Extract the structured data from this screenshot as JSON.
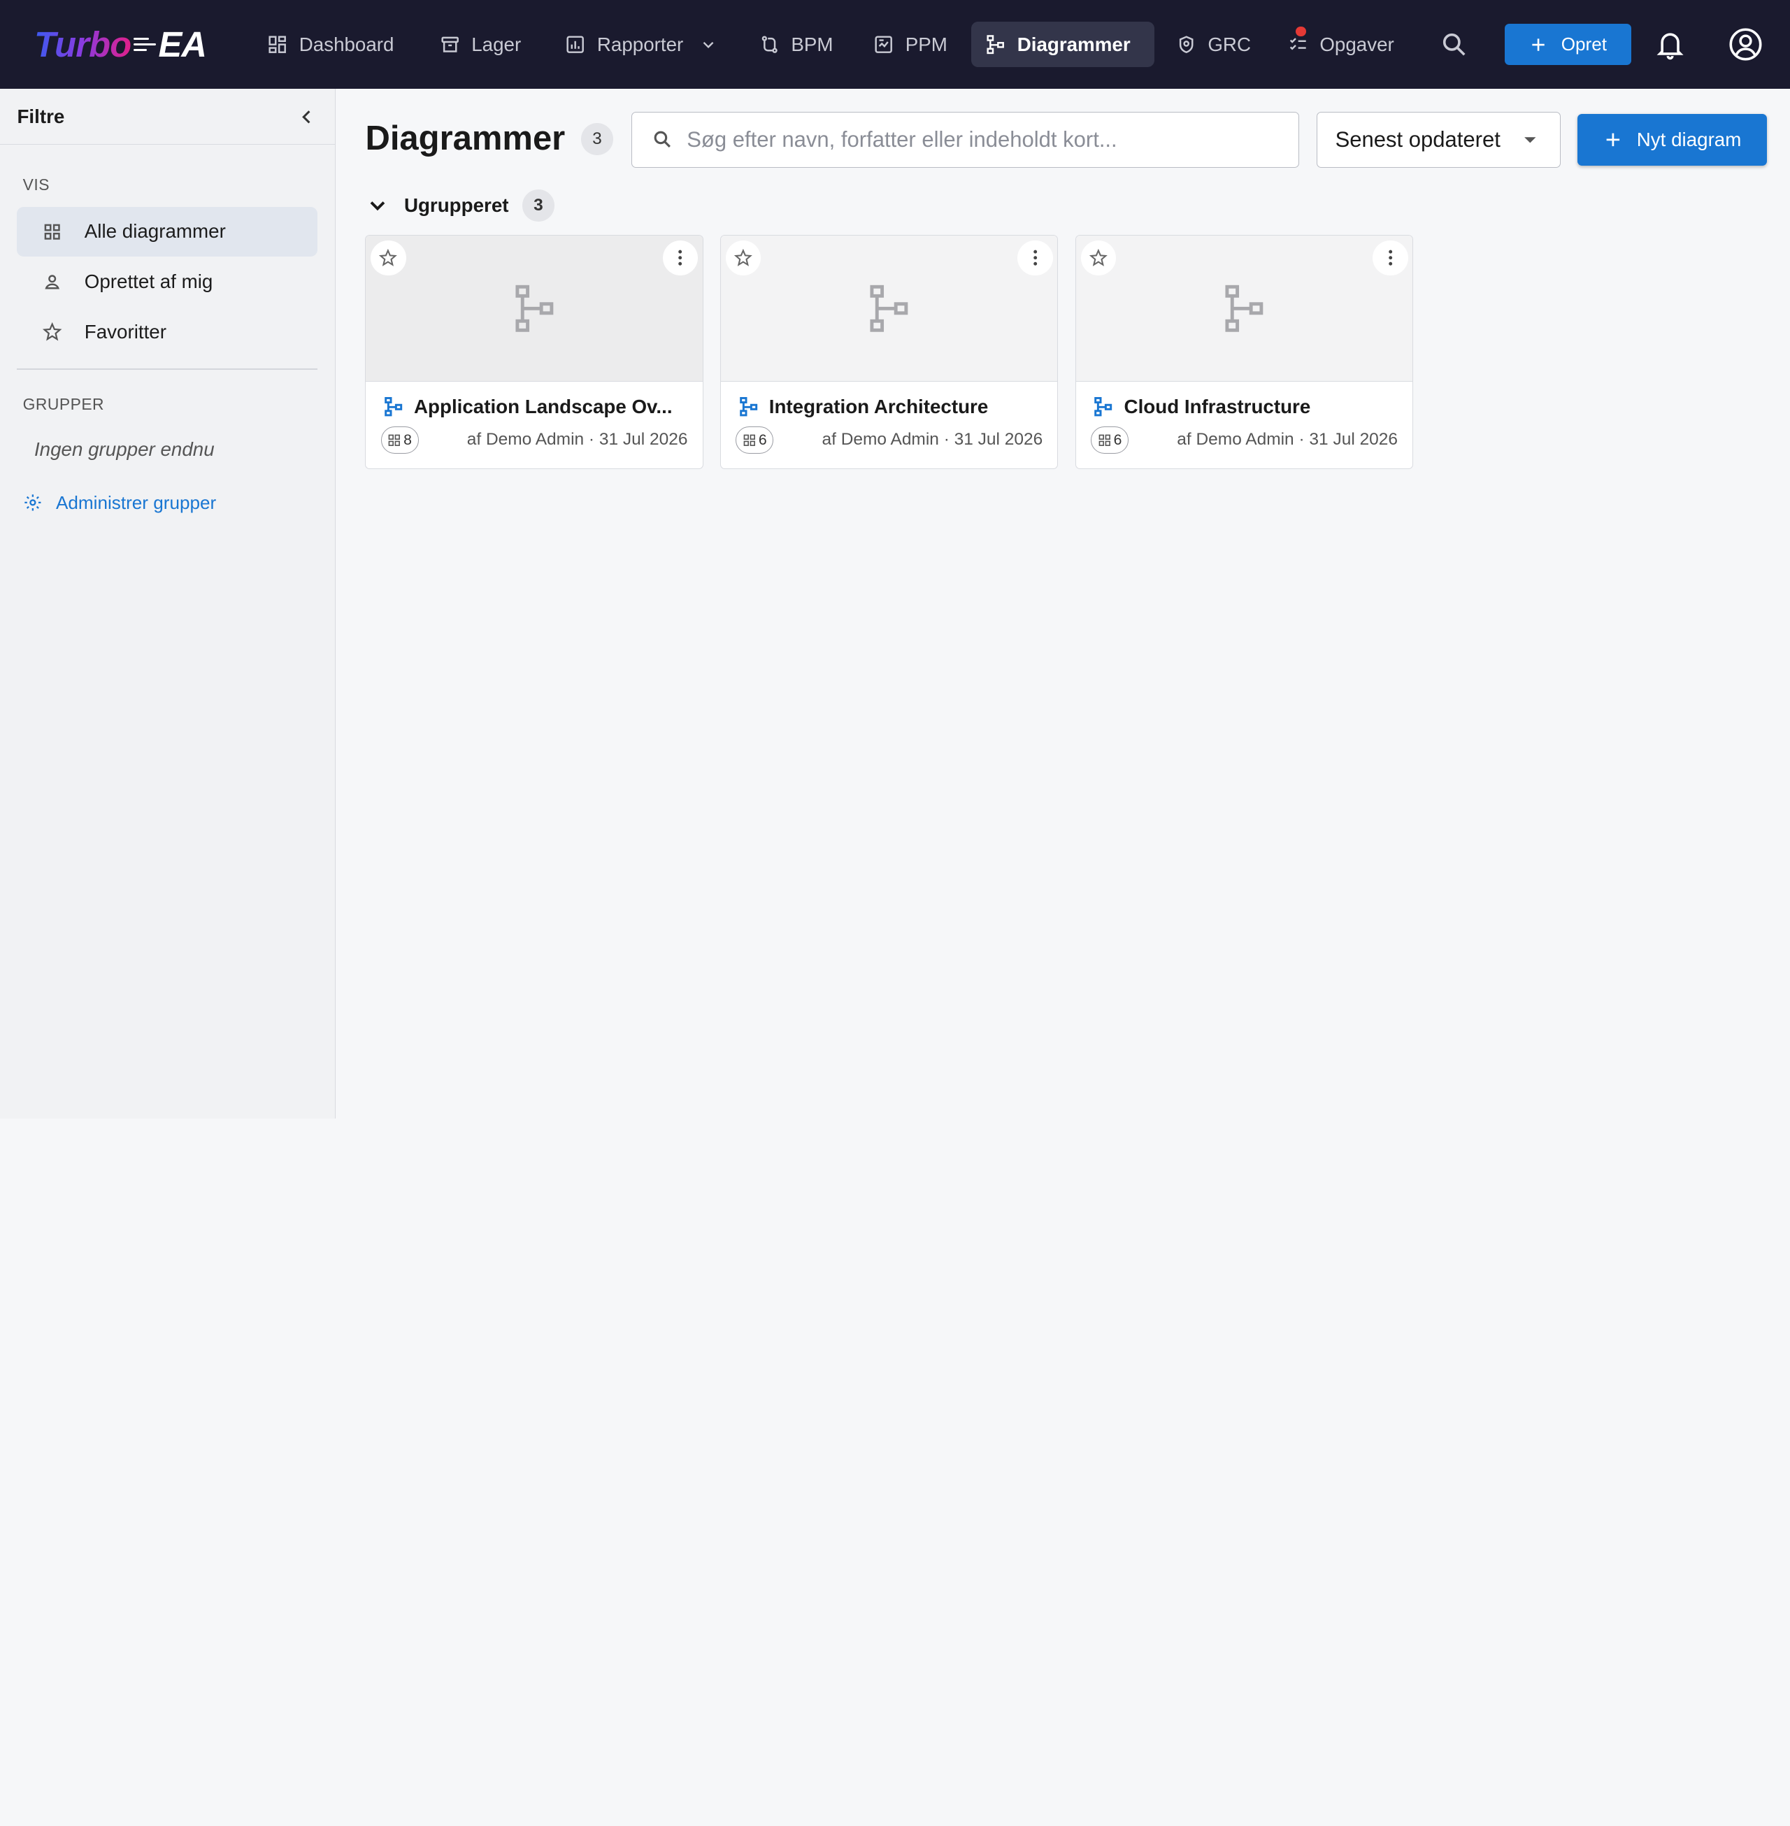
{
  "app": {
    "logo_part1": "Turbo",
    "logo_part2": "EA"
  },
  "nav": {
    "items": [
      {
        "label": "Dashboard",
        "icon": "dashboard-icon"
      },
      {
        "label": "Lager",
        "icon": "inventory-icon"
      },
      {
        "label": "Rapporter",
        "icon": "reports-icon"
      },
      {
        "label": "BPM",
        "icon": "bpm-icon"
      },
      {
        "label": "PPM",
        "icon": "ppm-icon"
      },
      {
        "label": "Diagrammer",
        "icon": "diagram-icon",
        "active": true
      },
      {
        "label": "GRC",
        "icon": "shield-icon"
      },
      {
        "label": "Opgaver",
        "icon": "tasks-icon"
      }
    ],
    "create_label": "Opret"
  },
  "sidebar": {
    "title": "Filtre",
    "view_section": "VIS",
    "view_items": [
      {
        "label": "Alle diagrammer",
        "icon": "grid-icon",
        "active": true
      },
      {
        "label": "Oprettet af mig",
        "icon": "person-icon"
      },
      {
        "label": "Favoritter",
        "icon": "star-icon"
      }
    ],
    "groups_section": "GRUPPER",
    "groups_empty": "Ingen grupper endnu",
    "manage_groups": "Administrer grupper"
  },
  "main": {
    "title": "Diagrammer",
    "total_count": "3",
    "search_placeholder": "Søg efter navn, forfatter eller indeholdt kort...",
    "sort_value": "Senest opdateret",
    "new_button": "Nyt diagram",
    "group": {
      "name": "Ugrupperet",
      "count": "3",
      "cards": [
        {
          "title": "Application Landscape Ov...",
          "card_count": "8",
          "meta": "af Demo Admin · 31 Jul 2026"
        },
        {
          "title": "Integration Architecture",
          "card_count": "6",
          "meta": "af Demo Admin · 31 Jul 2026"
        },
        {
          "title": "Cloud Infrastructure",
          "card_count": "6",
          "meta": "af Demo Admin · 31 Jul 2026"
        }
      ]
    }
  },
  "colors": {
    "topbar": "#1a1a2e",
    "primary": "#1976d2",
    "notification_dot": "#e53935"
  }
}
